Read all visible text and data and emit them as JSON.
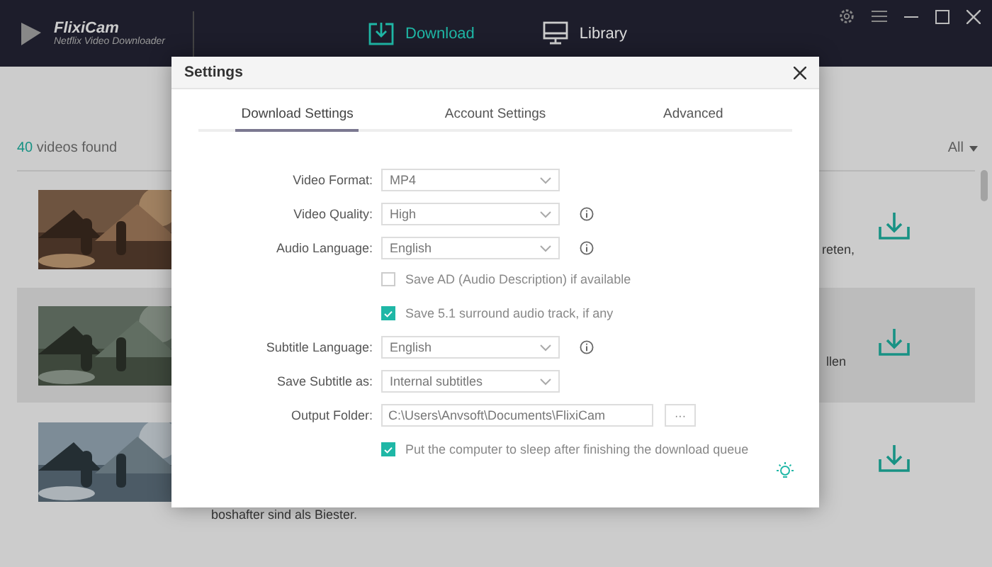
{
  "app": {
    "name": "FlixiCam",
    "subtitle": "Netflix Video Downloader"
  },
  "nav": [
    {
      "label": "Download",
      "kind": "download",
      "selected": true
    },
    {
      "label": "Library",
      "kind": "library",
      "selected": false
    }
  ],
  "results": {
    "count": "40",
    "label": "videos found",
    "filter": "All"
  },
  "videos": [
    {
      "kind": "picture",
      "text_fragment": "reten,",
      "selected": false
    },
    {
      "kind": "picture",
      "text_fragment": "llen",
      "selected": true
    },
    {
      "kind": "picture",
      "text_fragment": "boshafter sind als Biester.",
      "selected": false
    }
  ],
  "dialog": {
    "title": "Settings",
    "tabs": [
      {
        "label": "Download Settings",
        "selected": true
      },
      {
        "label": "Account Settings",
        "selected": false
      },
      {
        "label": "Advanced",
        "selected": false
      }
    ],
    "fields": [
      {
        "kind": "select",
        "label": "Video Format:",
        "value": "MP4"
      },
      {
        "kind": "selectinfo",
        "label": "Video Quality:",
        "value": "High"
      },
      {
        "kind": "selectinfo",
        "label": "Audio Language:",
        "value": "English"
      },
      {
        "kind": "checkbox",
        "label": "Save AD (Audio Description) if available",
        "checked": false
      },
      {
        "kind": "checkbox",
        "label": "Save 5.1 surround audio track, if any",
        "checked": true
      },
      {
        "kind": "selectinfo",
        "label": "Subtitle Language:",
        "value": "English"
      },
      {
        "kind": "select",
        "label": "Save Subtitle as:",
        "value": "Internal subtitles"
      },
      {
        "kind": "path",
        "label": "Output Folder:",
        "value": "C:\\Users\\Anvsoft\\Documents\\FlixiCam",
        "button": "···"
      },
      {
        "kind": "checkbox",
        "label": "Put the computer to sleep after finishing the download queue",
        "checked": true
      }
    ]
  }
}
